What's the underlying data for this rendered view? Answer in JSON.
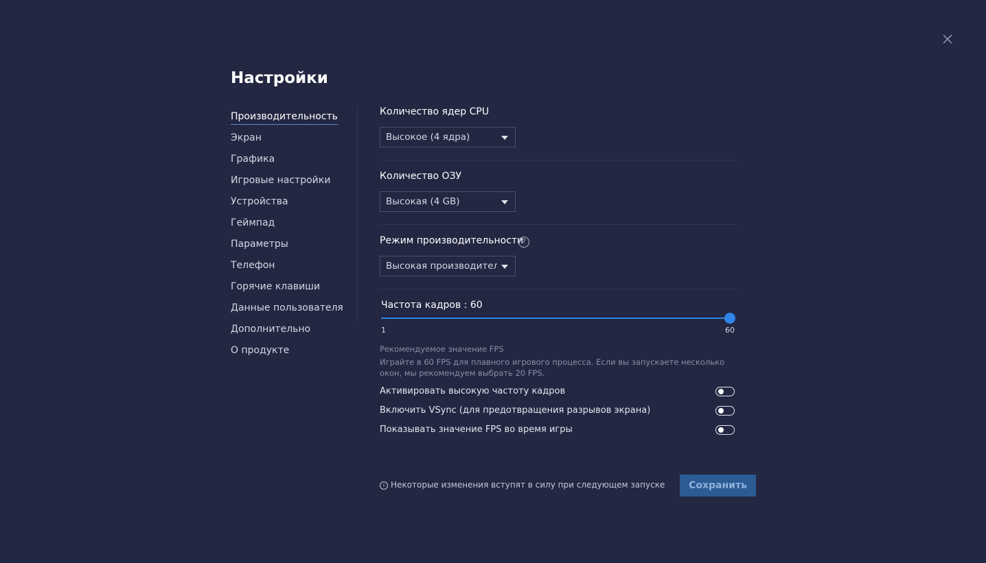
{
  "title": "Настройки",
  "close_icon": "close-icon",
  "sidebar": {
    "items": [
      {
        "label": "Производительность",
        "active": true
      },
      {
        "label": "Экран"
      },
      {
        "label": "Графика"
      },
      {
        "label": "Игровые настройки"
      },
      {
        "label": "Устройства"
      },
      {
        "label": "Геймпад"
      },
      {
        "label": "Параметры"
      },
      {
        "label": "Телефон"
      },
      {
        "label": "Горячие клавиши"
      },
      {
        "label": "Данные пользователя"
      },
      {
        "label": "Дополнительно"
      },
      {
        "label": "О продукте"
      }
    ]
  },
  "performance": {
    "cpu": {
      "label": "Количество ядер CPU",
      "value": "Высокое (4 ядра)"
    },
    "ram": {
      "label": "Количество ОЗУ",
      "value": "Высокая (4 GB)"
    },
    "mode": {
      "label": "Режим производительности",
      "value": "Высокая производительность",
      "help_glyph": "?"
    },
    "fps": {
      "label": "Частота кадров : 60",
      "min_label": "1",
      "max_label": "60",
      "min": 1,
      "max": 60,
      "value": 60
    },
    "recommendation_title": "Рекомендуемое значение FPS",
    "recommendation_text": "Играйте в 60 FPS для плавного игрового процесса. Если вы запускаете несколько окон, мы рекомендуем выбрать 20 FPS.",
    "toggles": [
      {
        "label": "Активировать высокую частоту кадров",
        "on": false
      },
      {
        "label": "Включить VSync (для предотвращения разрывов экрана)",
        "on": false
      },
      {
        "label": "Показывать значение FPS во время игры",
        "on": false
      }
    ]
  },
  "footer": {
    "info_glyph": "i",
    "note": "Некоторые изменения вступят в силу при следующем запуске",
    "save_label": "Сохранить"
  },
  "colors": {
    "background": "#232742",
    "accent": "#2f86e8",
    "save_button": "#2c5a93"
  }
}
